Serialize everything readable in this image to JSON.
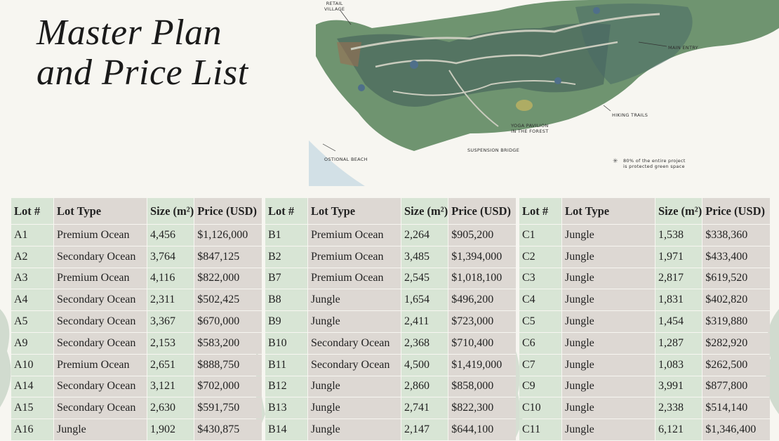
{
  "title": {
    "line1": "Master Plan",
    "line2": "and Price List"
  },
  "map": {
    "labels": {
      "retail_village": "RETAIL\nVILLAGE",
      "main_entry": "MAIN ENTRY",
      "hiking_trails": "HIKING TRAILS",
      "yoga_pavilion": "YOGA PAVILION\nIN THE FOREST",
      "suspension_bridge": "SUSPENSION BRIDGE",
      "ostional_beach": "OSTIONAL BEACH",
      "green_space": "80% of the entire project\nis protected green space"
    },
    "colors": {
      "forest": "#6f9470",
      "dark_lot": "#3e5a58",
      "trail": "#c9cbbd",
      "water": "#c8dbe3"
    }
  },
  "table_headers": [
    "Lot #",
    "Lot Type",
    "Size (m²)",
    "Price (USD)"
  ],
  "tables": [
    {
      "rows": [
        [
          "A1",
          "Premium Ocean",
          "4,456",
          "$1,126,000"
        ],
        [
          "A2",
          "Secondary Ocean",
          "3,764",
          "$847,125"
        ],
        [
          "A3",
          "Premium Ocean",
          "4,116",
          "$822,000"
        ],
        [
          "A4",
          "Secondary Ocean",
          "2,311",
          "$502,425"
        ],
        [
          "A5",
          "Secondary Ocean",
          "3,367",
          "$670,000"
        ],
        [
          "A9",
          "Secondary Ocean",
          "2,153",
          "$583,200"
        ],
        [
          "A10",
          "Premium Ocean",
          "2,651",
          "$888,750"
        ],
        [
          "A14",
          "Secondary Ocean",
          "3,121",
          "$702,000"
        ],
        [
          "A15",
          "Secondary Ocean",
          "2,630",
          "$591,750"
        ],
        [
          "A16",
          "Jungle",
          "1,902",
          "$430,875"
        ]
      ]
    },
    {
      "rows": [
        [
          "B1",
          "Premium Ocean",
          "2,264",
          "$905,200"
        ],
        [
          "B2",
          "Premium Ocean",
          "3,485",
          "$1,394,000"
        ],
        [
          "B7",
          "Premium Ocean",
          "2,545",
          "$1,018,100"
        ],
        [
          "B8",
          "Jungle",
          "1,654",
          "$496,200"
        ],
        [
          "B9",
          "Jungle",
          "2,411",
          "$723,000"
        ],
        [
          "B10",
          "Secondary Ocean",
          "2,368",
          "$710,400"
        ],
        [
          "B11",
          "Secondary Ocean",
          "4,500",
          "$1,419,000"
        ],
        [
          "B12",
          "Jungle",
          "2,860",
          "$858,000"
        ],
        [
          "B13",
          "Jungle",
          "2,741",
          "$822,300"
        ],
        [
          "B14",
          "Jungle",
          "2,147",
          "$644,100"
        ]
      ]
    },
    {
      "rows": [
        [
          "C1",
          "Jungle",
          "1,538",
          "$338,360"
        ],
        [
          "C2",
          "Jungle",
          "1,971",
          "$433,400"
        ],
        [
          "C3",
          "Jungle",
          "2,817",
          "$619,520"
        ],
        [
          "C4",
          "Jungle",
          "1,831",
          "$402,820"
        ],
        [
          "C5",
          "Jungle",
          "1,454",
          "$319,880"
        ],
        [
          "C6",
          "Jungle",
          "1,287",
          "$282,920"
        ],
        [
          "C7",
          "Jungle",
          "1,083",
          "$262,500"
        ],
        [
          "C9",
          "Jungle",
          "3,991",
          "$877,800"
        ],
        [
          "C10",
          "Jungle",
          "2,338",
          "$514,140"
        ],
        [
          "C11",
          "Jungle",
          "6,121",
          "$1,346,400"
        ]
      ]
    }
  ]
}
